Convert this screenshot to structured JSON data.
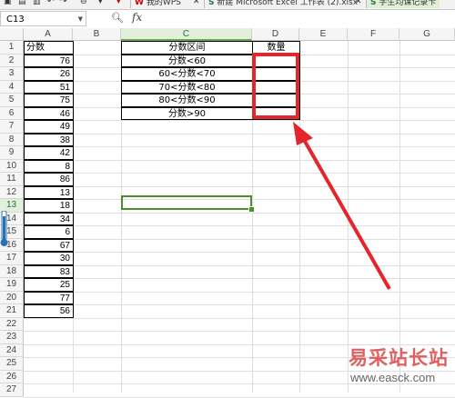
{
  "app": {
    "tabs": [
      {
        "label": "我的WPS"
      },
      {
        "label": "新建 Microsoft Excel 工作表 (2).xlsx"
      },
      {
        "label": "学生均课记录卡"
      }
    ]
  },
  "formula_bar": {
    "cell_ref": "C13",
    "fx_label": "fx",
    "value": ""
  },
  "columns": [
    "A",
    "B",
    "C",
    "D",
    "E",
    "F",
    "G"
  ],
  "rows": [
    "1",
    "2",
    "3",
    "4",
    "5",
    "6",
    "7",
    "8",
    "9",
    "10",
    "11",
    "12",
    "13",
    "14",
    "15",
    "16",
    "17",
    "18",
    "19",
    "20",
    "21",
    "22",
    "23",
    "24",
    "25",
    "26",
    "27"
  ],
  "colA": {
    "header": "分数",
    "values": [
      "76",
      "26",
      "51",
      "75",
      "46",
      "49",
      "38",
      "42",
      "8",
      "86",
      "13",
      "18",
      "34",
      "6",
      "67",
      "30",
      "83",
      "25",
      "77",
      "56"
    ]
  },
  "table": {
    "header_c": "分数区间",
    "header_d": "数量",
    "ranges": [
      "分数<60",
      "60<分数<70",
      "70<分数<80",
      "80<分数<90",
      "分数>90"
    ],
    "counts": [
      "",
      "",
      "",
      "",
      ""
    ]
  },
  "selection": {
    "cell": "C13",
    "selected_col": "C",
    "selected_row": "13"
  },
  "annotation": {
    "box_color": "#e2262c",
    "arrow_color": "#e2262c"
  },
  "watermark": {
    "title": "易采站长站",
    "url": "www.easck.com"
  }
}
